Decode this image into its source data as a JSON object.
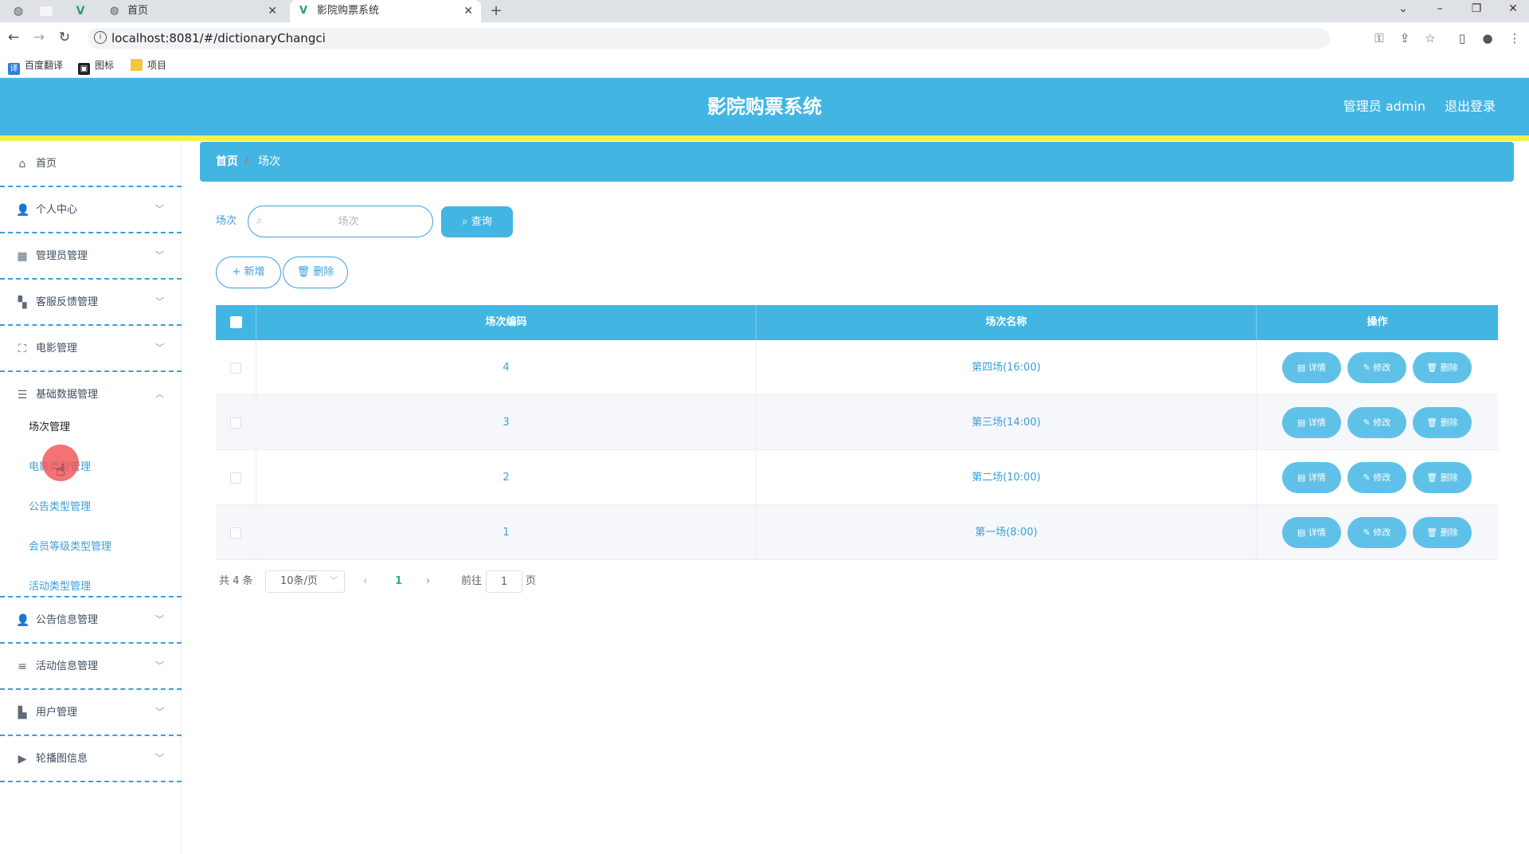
{
  "browser": {
    "tabs": [
      {
        "label": "首页",
        "active": false
      },
      {
        "label": "影院购票系统",
        "active": true
      }
    ],
    "url": "localhost:8081/#/dictionaryChangci",
    "bookmarks": [
      "百度翻译",
      "图标",
      "项目"
    ]
  },
  "header": {
    "title": "影院购票系统",
    "admin": "管理员 admin",
    "logout": "退出登录",
    "color": "#43b5e3"
  },
  "sidebar": {
    "items": [
      {
        "label": "首页",
        "icon": "home-icon"
      },
      {
        "label": "个人中心",
        "icon": "user-icon"
      },
      {
        "label": "管理员管理",
        "icon": "clipboard-icon"
      },
      {
        "label": "客服反馈管理",
        "icon": "grid-icon"
      },
      {
        "label": "电影管理",
        "icon": "fullscreen-icon"
      },
      {
        "label": "基础数据管理",
        "icon": "sliders-icon"
      },
      {
        "label": "公告信息管理",
        "icon": "user-icon"
      },
      {
        "label": "活动信息管理",
        "icon": "list-icon"
      },
      {
        "label": "用户管理",
        "icon": "briefcase-icon"
      },
      {
        "label": "轮播图信息",
        "icon": "video-icon"
      }
    ],
    "subitems": [
      "场次管理",
      "电影类型管理",
      "公告类型管理",
      "会员等级类型管理",
      "活动类型管理"
    ]
  },
  "breadcrumb": {
    "home": "首页",
    "separator": "/",
    "current": "场次"
  },
  "search": {
    "label": "场次",
    "placeholder": "场次",
    "button": "查询"
  },
  "actions": {
    "add": "+ 新增",
    "delete": "删除"
  },
  "table": {
    "headers": [
      "场次编码",
      "场次名称",
      "操作"
    ],
    "rows": [
      {
        "code": "4",
        "name": "第四场(16:00)"
      },
      {
        "code": "3",
        "name": "第三场(14:00)"
      },
      {
        "code": "2",
        "name": "第二场(10:00)"
      },
      {
        "code": "1",
        "name": "第一场(8:00)"
      }
    ],
    "row_actions": {
      "detail": "详情",
      "edit": "修改",
      "delete": "删除"
    }
  },
  "pagination": {
    "total": "共 4 条",
    "page_size": "10条/页",
    "current_page": "1",
    "goto": "前往",
    "goto_value": "1",
    "unit": "页"
  }
}
